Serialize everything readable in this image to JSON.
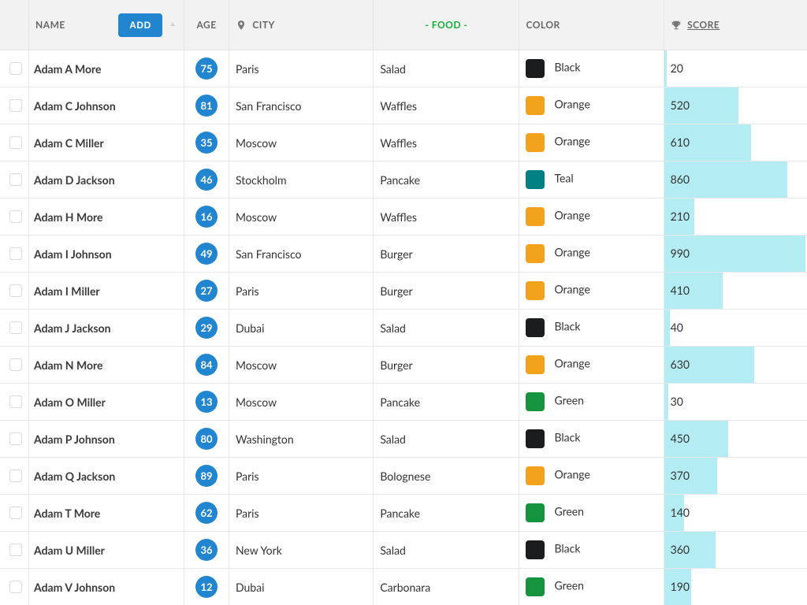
{
  "header": {
    "name_label": "NAME",
    "add_label": "ADD",
    "age_label": "AGE",
    "city_label": "CITY",
    "food_label": "- FOOD -",
    "color_label": "COLOR",
    "score_label": "SCORE"
  },
  "colors": {
    "Black": "#1b1c1d",
    "Orange": "#f2a31b",
    "Teal": "#008080",
    "Green": "#16933e"
  },
  "score_max": 1000,
  "rows": [
    {
      "name": "Adam A More",
      "age": 75,
      "city": "Paris",
      "food": "Salad",
      "color": "Black",
      "score": 20
    },
    {
      "name": "Adam C Johnson",
      "age": 81,
      "city": "San Francisco",
      "food": "Waffles",
      "color": "Orange",
      "score": 520
    },
    {
      "name": "Adam C Miller",
      "age": 35,
      "city": "Moscow",
      "food": "Waffles",
      "color": "Orange",
      "score": 610
    },
    {
      "name": "Adam D Jackson",
      "age": 46,
      "city": "Stockholm",
      "food": "Pancake",
      "color": "Teal",
      "score": 860
    },
    {
      "name": "Adam H More",
      "age": 16,
      "city": "Moscow",
      "food": "Waffles",
      "color": "Orange",
      "score": 210
    },
    {
      "name": "Adam I Johnson",
      "age": 49,
      "city": "San Francisco",
      "food": "Burger",
      "color": "Orange",
      "score": 990
    },
    {
      "name": "Adam I Miller",
      "age": 27,
      "city": "Paris",
      "food": "Burger",
      "color": "Orange",
      "score": 410
    },
    {
      "name": "Adam J Jackson",
      "age": 29,
      "city": "Dubai",
      "food": "Salad",
      "color": "Black",
      "score": 40
    },
    {
      "name": "Adam N More",
      "age": 84,
      "city": "Moscow",
      "food": "Burger",
      "color": "Orange",
      "score": 630
    },
    {
      "name": "Adam O Miller",
      "age": 13,
      "city": "Moscow",
      "food": "Pancake",
      "color": "Green",
      "score": 30
    },
    {
      "name": "Adam P Johnson",
      "age": 80,
      "city": "Washington",
      "food": "Salad",
      "color": "Black",
      "score": 450
    },
    {
      "name": "Adam Q Jackson",
      "age": 89,
      "city": "Paris",
      "food": "Bolognese",
      "color": "Orange",
      "score": 370
    },
    {
      "name": "Adam T More",
      "age": 62,
      "city": "Paris",
      "food": "Pancake",
      "color": "Green",
      "score": 140
    },
    {
      "name": "Adam U Miller",
      "age": 36,
      "city": "New York",
      "food": "Salad",
      "color": "Black",
      "score": 360
    },
    {
      "name": "Adam V Johnson",
      "age": 12,
      "city": "Dubai",
      "food": "Carbonara",
      "color": "Green",
      "score": 190
    }
  ]
}
